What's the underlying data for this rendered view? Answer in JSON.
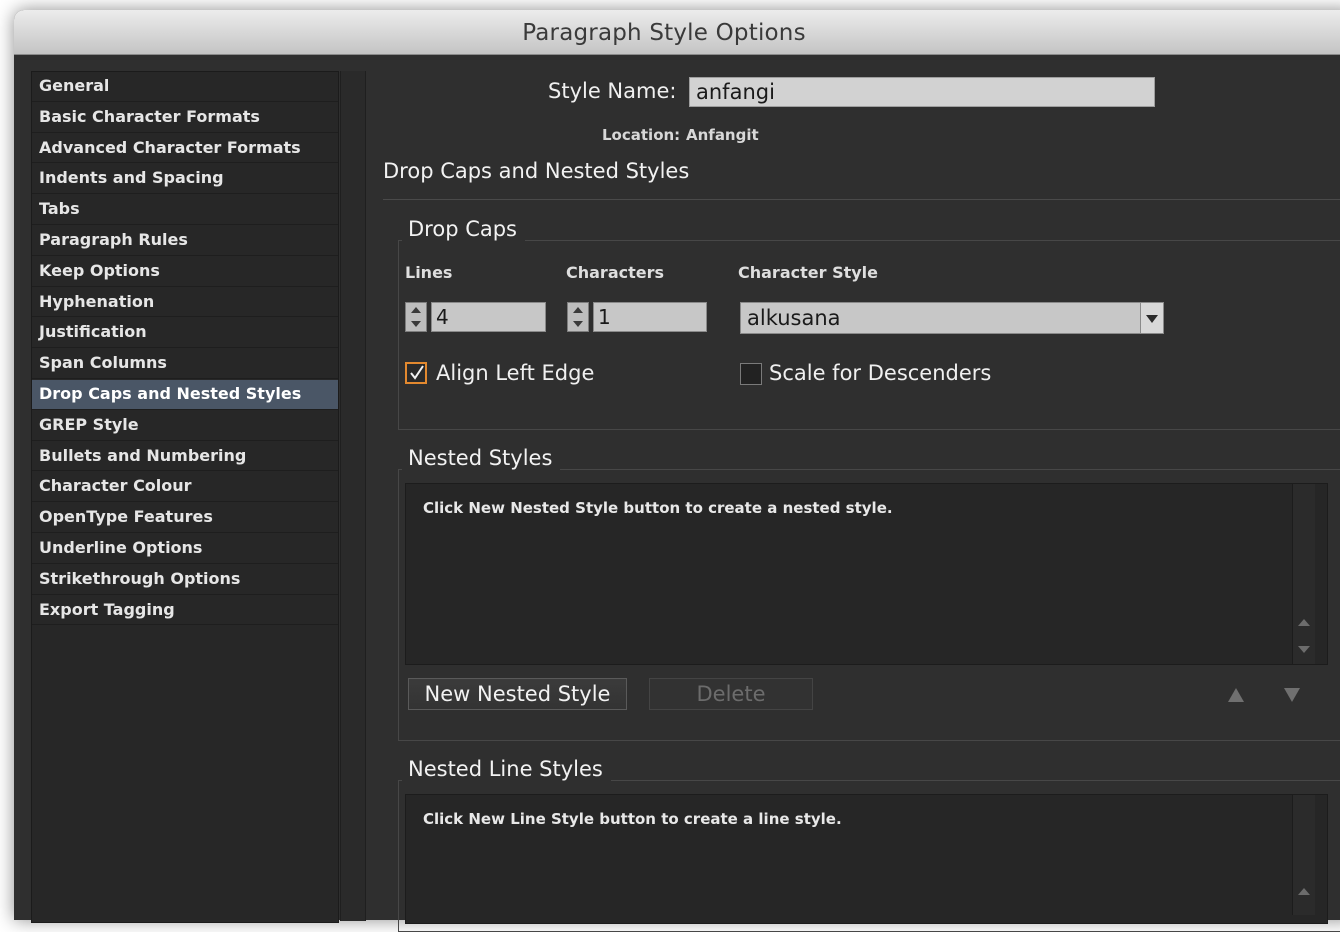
{
  "window": {
    "title": "Paragraph Style Options"
  },
  "sidebar": {
    "items": [
      {
        "label": "General"
      },
      {
        "label": "Basic Character Formats"
      },
      {
        "label": "Advanced Character Formats"
      },
      {
        "label": "Indents and Spacing"
      },
      {
        "label": "Tabs"
      },
      {
        "label": "Paragraph Rules"
      },
      {
        "label": "Keep Options"
      },
      {
        "label": "Hyphenation"
      },
      {
        "label": "Justification"
      },
      {
        "label": "Span Columns"
      },
      {
        "label": "Drop Caps and Nested Styles"
      },
      {
        "label": "GREP Style"
      },
      {
        "label": "Bullets and Numbering"
      },
      {
        "label": "Character Colour"
      },
      {
        "label": "OpenType Features"
      },
      {
        "label": "Underline Options"
      },
      {
        "label": "Strikethrough Options"
      },
      {
        "label": "Export Tagging"
      }
    ],
    "selected_label": "Drop Caps and Nested Styles"
  },
  "header": {
    "style_name_label": "Style Name:",
    "style_name_value": "anfangi",
    "location_label": "Location:",
    "location_value": "Anfangit"
  },
  "section": {
    "title": "Drop Caps and Nested Styles"
  },
  "drop_caps": {
    "legend": "Drop Caps",
    "lines_label": "Lines",
    "lines_value": "4",
    "characters_label": "Characters",
    "characters_value": "1",
    "character_style_label": "Character Style",
    "character_style_value": "alkusana",
    "align_left_edge_label": "Align Left Edge",
    "align_left_edge_checked": true,
    "scale_descenders_label": "Scale for Descenders",
    "scale_descenders_checked": false
  },
  "nested_styles": {
    "legend": "Nested Styles",
    "hint": "Click New Nested Style button to create a nested style.",
    "new_button": "New Nested Style",
    "delete_button": "Delete"
  },
  "nested_line_styles": {
    "legend": "Nested Line Styles",
    "hint": "Click New Line Style button to create a line style."
  },
  "colors": {
    "window_bg": "#2f2f2f",
    "selected_bg": "#4a5666",
    "checkbox_accent": "#e3892f"
  }
}
